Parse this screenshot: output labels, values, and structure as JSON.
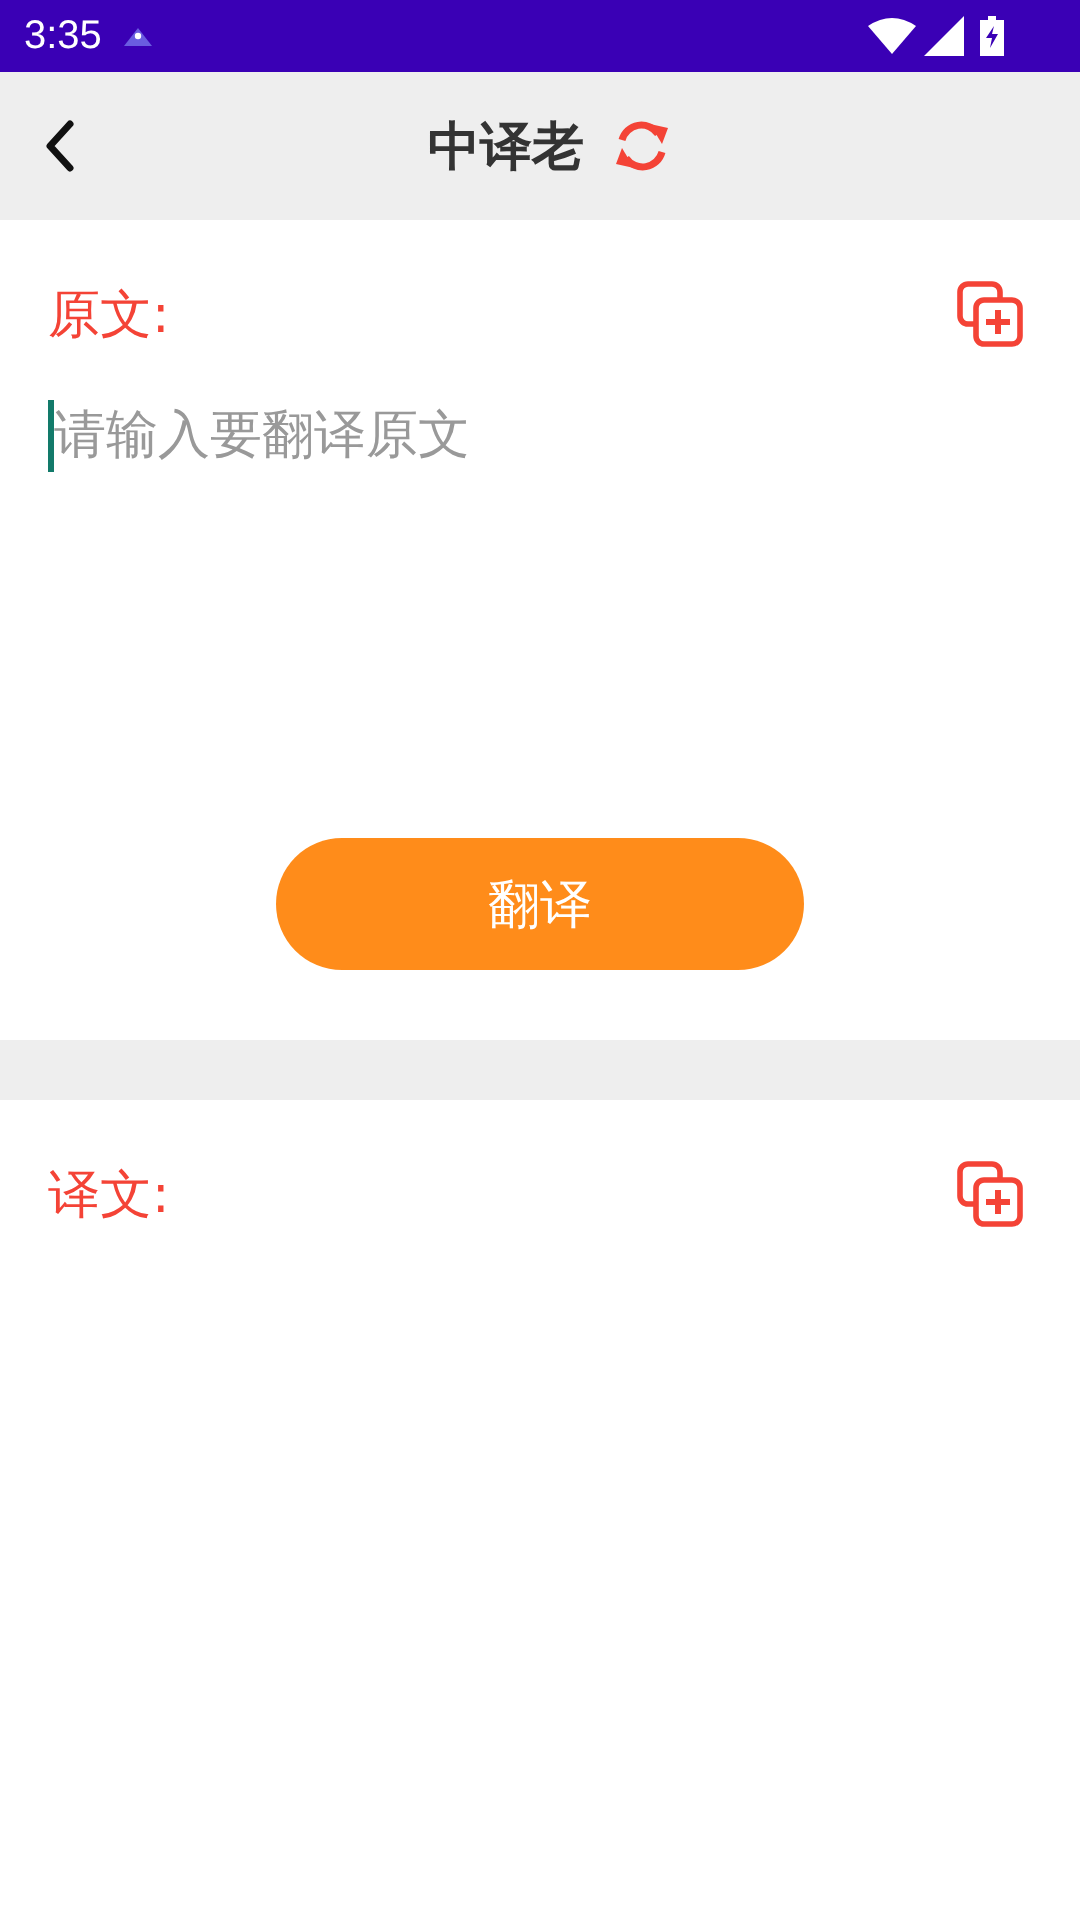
{
  "status_bar": {
    "time": "3:35"
  },
  "header": {
    "title": "中译老"
  },
  "source": {
    "label": "原文:",
    "placeholder": "请输入要翻译原文"
  },
  "translate_button": {
    "label": "翻译"
  },
  "target": {
    "label": "译文:"
  }
}
